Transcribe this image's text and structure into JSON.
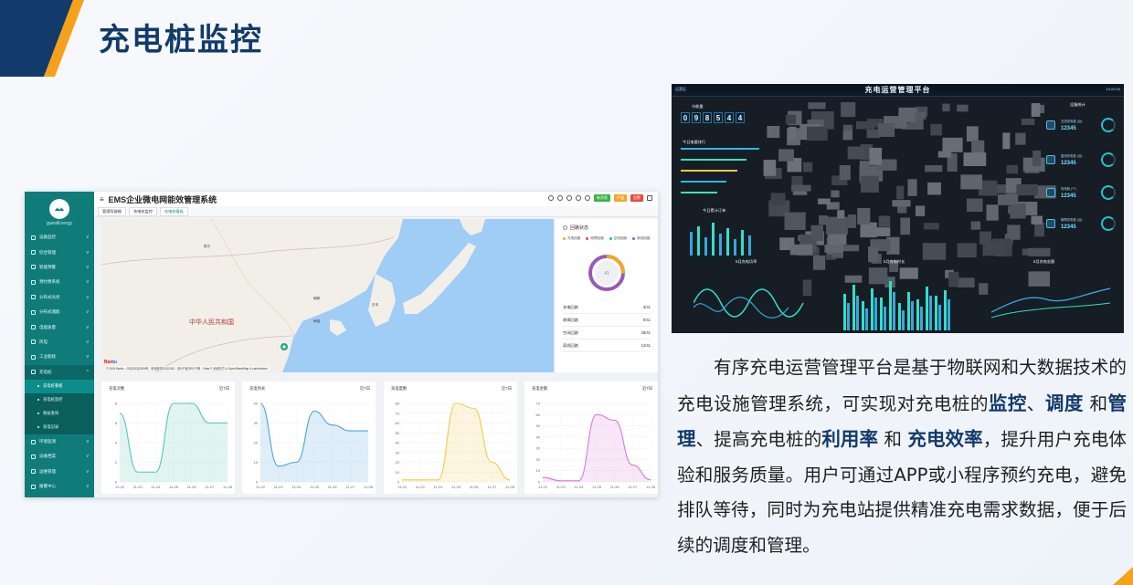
{
  "slide": {
    "title": "充电桩监控"
  },
  "app": {
    "title": "EMS企业微电网能效管理系统",
    "user": "guestEnergy",
    "nav": [
      {
        "label": "设备监控"
      },
      {
        "label": "综合管理"
      },
      {
        "label": "智能预警"
      },
      {
        "label": "预付费系统"
      },
      {
        "label": "分布式光伏"
      },
      {
        "label": "分布式储能"
      },
      {
        "label": "电能质量"
      },
      {
        "label": "风电"
      },
      {
        "label": "工业能耗"
      },
      {
        "label": "充电桩"
      }
    ],
    "subnav": [
      "充电桩看板",
      "充电桩监控",
      "收益查询",
      "充电记录"
    ],
    "nav_after": [
      {
        "label": "环境监测"
      },
      {
        "label": "设备档案"
      },
      {
        "label": "运维管理"
      },
      {
        "label": "报警中心"
      }
    ],
    "tabs": [
      "管理驾驶舱",
      "充电桩监控",
      "充电桩看板"
    ],
    "buttons": {
      "a": "新消息",
      "b": "产量",
      "c": "告警"
    },
    "map": {
      "country_label": "中华人民共和国",
      "places": [
        "蒙古",
        "朝鲜",
        "韩国",
        "日本"
      ],
      "attribution": "© 2024 Baidu - GS(2023)3206号 - 甲测资字11111342 - 京ICP证030173号 - Data © 长地万方 & OpenStreetMap & contributors"
    },
    "status": {
      "title": "回路状态",
      "legend": [
        {
          "label": "充电回路",
          "color": "#f5a623"
        },
        {
          "label": "故障回路",
          "color": "#e74c3c"
        },
        {
          "label": "空闲回路",
          "color": "#3aa6dd"
        },
        {
          "label": "离线回路",
          "color": "#9b59b6"
        }
      ],
      "total": "41",
      "rows": [
        {
          "label": "充电回路",
          "value": "3/41"
        },
        {
          "label": "故障回路",
          "value": "0/41"
        },
        {
          "label": "空闲回路",
          "value": "26/41"
        },
        {
          "label": "离线回路",
          "value": "12/41"
        }
      ]
    },
    "mini_charts": [
      {
        "title": "充电次数",
        "period": "近7日",
        "color": "#52c7b8"
      },
      {
        "title": "充电时长",
        "period": "近7日",
        "color": "#4da3d9"
      },
      {
        "title": "充电度数",
        "period": "近7日",
        "color": "#f2c94c"
      },
      {
        "title": "充电金额",
        "period": "近7日",
        "color": "#d77bd6"
      }
    ]
  },
  "chart_data": [
    {
      "type": "area",
      "title": "充电次数",
      "categories": [
        "11-22",
        "11-23",
        "11-24",
        "11-25",
        "11-26",
        "11-27",
        "11-28"
      ],
      "values": [
        7,
        1,
        1,
        8,
        8,
        6,
        6
      ],
      "yticks": [
        0,
        2,
        4,
        6,
        8
      ],
      "ylim": [
        0,
        8
      ]
    },
    {
      "type": "area",
      "title": "充电时长",
      "categories": [
        "11-22",
        "11-23",
        "11-24",
        "11-25",
        "11-26",
        "11-27",
        "11-28"
      ],
      "values": [
        40,
        8,
        10,
        36,
        29,
        26,
        26
      ],
      "yticks": [
        0,
        10,
        20,
        30,
        40
      ],
      "ylim": [
        0,
        40
      ]
    },
    {
      "type": "area",
      "title": "充电度数",
      "categories": [
        "11-22",
        "11-23",
        "11-24",
        "11-25",
        "11-26",
        "11-27",
        "11-28"
      ],
      "values": [
        2,
        2,
        2,
        80,
        75,
        20,
        2
      ],
      "yticks": [
        0,
        10,
        20,
        30,
        40,
        50,
        60,
        70,
        80
      ],
      "ylim": [
        0,
        80
      ]
    },
    {
      "type": "area",
      "title": "充电金额",
      "categories": [
        "11-22",
        "11-23",
        "11-24",
        "11-25",
        "11-26",
        "11-27",
        "11-28"
      ],
      "values": [
        4,
        1,
        1,
        60,
        55,
        15,
        2
      ],
      "yticks": [
        0,
        10,
        20,
        30,
        40,
        50,
        60,
        70
      ],
      "ylim": [
        0,
        70
      ]
    }
  ],
  "platform": {
    "title": "充电运营管理平台",
    "loc": "运营区",
    "time": "16:00:05",
    "counter_label": "节能量",
    "counter": [
      "0",
      "9",
      "8",
      "5",
      "4",
      "4"
    ],
    "left_labels": [
      "今日电量排行",
      "今日累计订单"
    ],
    "right_label": "设备统计",
    "stats": [
      {
        "label": "交流充电桩 (台)",
        "value": "12345"
      },
      {
        "label": "直流充电桩 (台)",
        "value": "12345"
      },
      {
        "label": "充电枪 (个)",
        "value": "12345"
      },
      {
        "label": "故障充电桩 (台)",
        "value": "12345"
      }
    ],
    "bottom_labels": [
      "5月充电功率",
      "5月充电时长",
      "5月充电金额"
    ]
  },
  "description": {
    "p1": "有序充电运营管理平台是基于物联网和大数据技术的充电设施管理系统，可实现对充电桩的",
    "kw1": "监控",
    "sep1": "、",
    "kw2": "调度",
    "and1": " 和",
    "kw3": "管理",
    "p2": "、提高充电桩的",
    "kw4": "利用率",
    "and2": " 和 ",
    "kw5": "充电效率",
    "p3": "，提升用户充电体验和服务质量。用户可通过APP或小程序预约充电，避免排队等待，同时为充电站提供精准充电需求数据，便于后续的调度和管理。"
  }
}
